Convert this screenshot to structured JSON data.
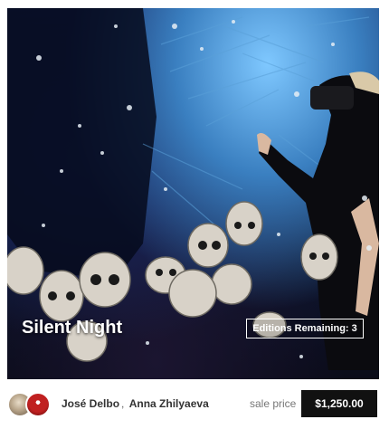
{
  "artwork": {
    "title": "Silent Night",
    "editions_label": "Editions Remaining:",
    "editions_count": "3"
  },
  "artists": {
    "first": "José Delbo",
    "separator": ",",
    "second": "Anna Zhilyaeva"
  },
  "sale": {
    "label": "sale price",
    "price": "$1,250.00"
  },
  "colors": {
    "price_bg": "#111111",
    "text_main": "#333333",
    "text_muted": "#777777"
  }
}
